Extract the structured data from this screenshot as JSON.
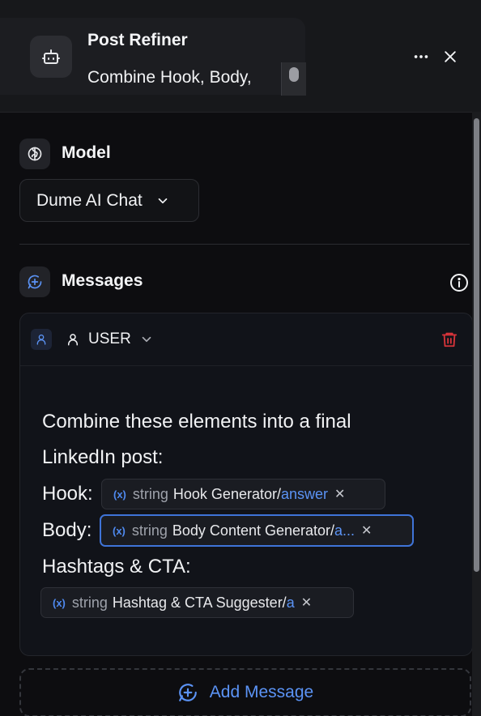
{
  "header": {
    "title": "Post Refiner",
    "subtitle": "Combine Hook, Body,",
    "agent_icon": "robot-icon",
    "more_icon": "more-horizontal-icon",
    "close_icon": "close-icon"
  },
  "model": {
    "label": "Model",
    "icon": "brain-icon",
    "selected": "Dume AI Chat"
  },
  "messages": {
    "label": "Messages",
    "icon": "message-plus-icon",
    "info_icon": "info-icon",
    "items": [
      {
        "role": "USER",
        "lines": [
          "Combine these elements into a final",
          "LinkedIn post:",
          "Hook:",
          "Body:",
          "Hashtags & CTA:"
        ],
        "variables": [
          {
            "type": "string",
            "node": "Hook Generator/",
            "field": "answer"
          },
          {
            "type": "string",
            "node": "Body Content Generator/",
            "field": "a..."
          },
          {
            "type": "string",
            "node": "Hashtag & CTA Suggester/",
            "field": "a"
          }
        ]
      }
    ],
    "add_label": "Add Message"
  },
  "colors": {
    "accent": "#5b93f5",
    "danger": "#d8343a",
    "background": "#0d0d10"
  }
}
